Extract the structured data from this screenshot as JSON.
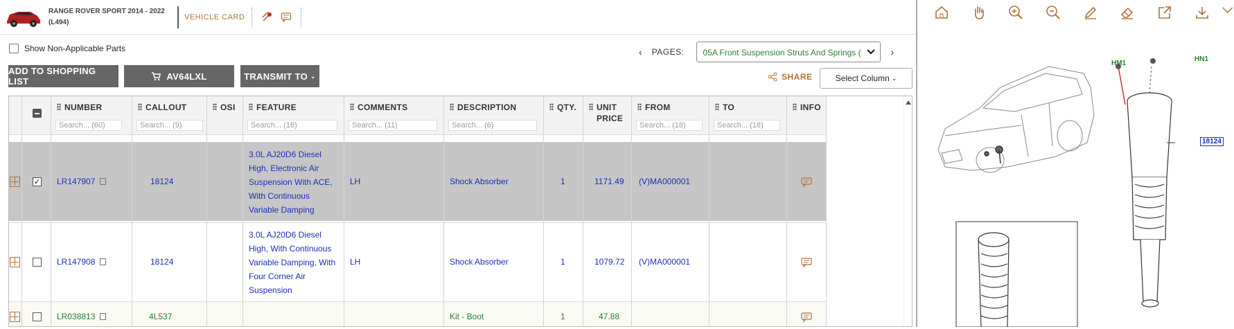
{
  "header": {
    "model_line1": "RANGE ROVER SPORT 2014 - 2022",
    "model_line2": "(L494)",
    "vehicle_card": "VEHICLE CARD"
  },
  "filters": {
    "show_non_applicable": "Show Non-Applicable Parts",
    "pages_label": "PAGES:",
    "page_selected": "05A Front Suspension Struts And Springs (..."
  },
  "actions": {
    "add_to_list": "ADD TO SHOPPING LIST",
    "cart_code": "AV64LXL",
    "transmit": "TRANSMIT TO",
    "share": "SHARE",
    "select_column": "Select Column"
  },
  "columns": [
    {
      "name": "NUMBER",
      "search": "Search... (60)"
    },
    {
      "name": "CALLOUT",
      "search": "Search... (9)"
    },
    {
      "name": "OSI",
      "search": ""
    },
    {
      "name": "FEATURE",
      "search": "Search... (16)"
    },
    {
      "name": "COMMENTS",
      "search": "Search... (11)"
    },
    {
      "name": "DESCRIPTION",
      "search": "Search... (6)"
    },
    {
      "name": "QTY.",
      "search": ""
    },
    {
      "name": "UNIT",
      "name2": "PRICE",
      "search": ""
    },
    {
      "name": "FROM",
      "search": "Search... (18)"
    },
    {
      "name": "TO",
      "search": "Search... (18)"
    },
    {
      "name": "INFO",
      "search": ""
    }
  ],
  "rows": [
    {
      "number": "LR147907",
      "callout": "18124",
      "feature": [
        "3.0L AJ20D6 Diesel",
        "High, Electronic Air",
        "Suspension With ACE,",
        "With Continuous",
        "Variable Damping"
      ],
      "comments": "LH",
      "description": "Shock Absorber",
      "qty": "1",
      "price": "1171.49",
      "from": "(V)MA000001",
      "to": "",
      "checked": true
    },
    {
      "number": "LR147908",
      "callout": "18124",
      "feature": [
        "3.0L AJ20D6 Diesel",
        "High, With Continuous",
        "Variable Damping, With",
        "Four Corner Air",
        "Suspension"
      ],
      "comments": "LH",
      "description": "Shock Absorber",
      "qty": "1",
      "price": "1079.72",
      "from": "(V)MA000001",
      "to": "",
      "checked": false
    },
    {
      "number": "LR038813",
      "callout": "4L537",
      "feature": [],
      "comments": "",
      "description": "Kit - Boot",
      "qty": "1",
      "price": "47.88",
      "from": "",
      "to": "",
      "checked": false
    }
  ],
  "diagram": {
    "labels": [
      "HM1",
      "HN1",
      "18124"
    ]
  }
}
